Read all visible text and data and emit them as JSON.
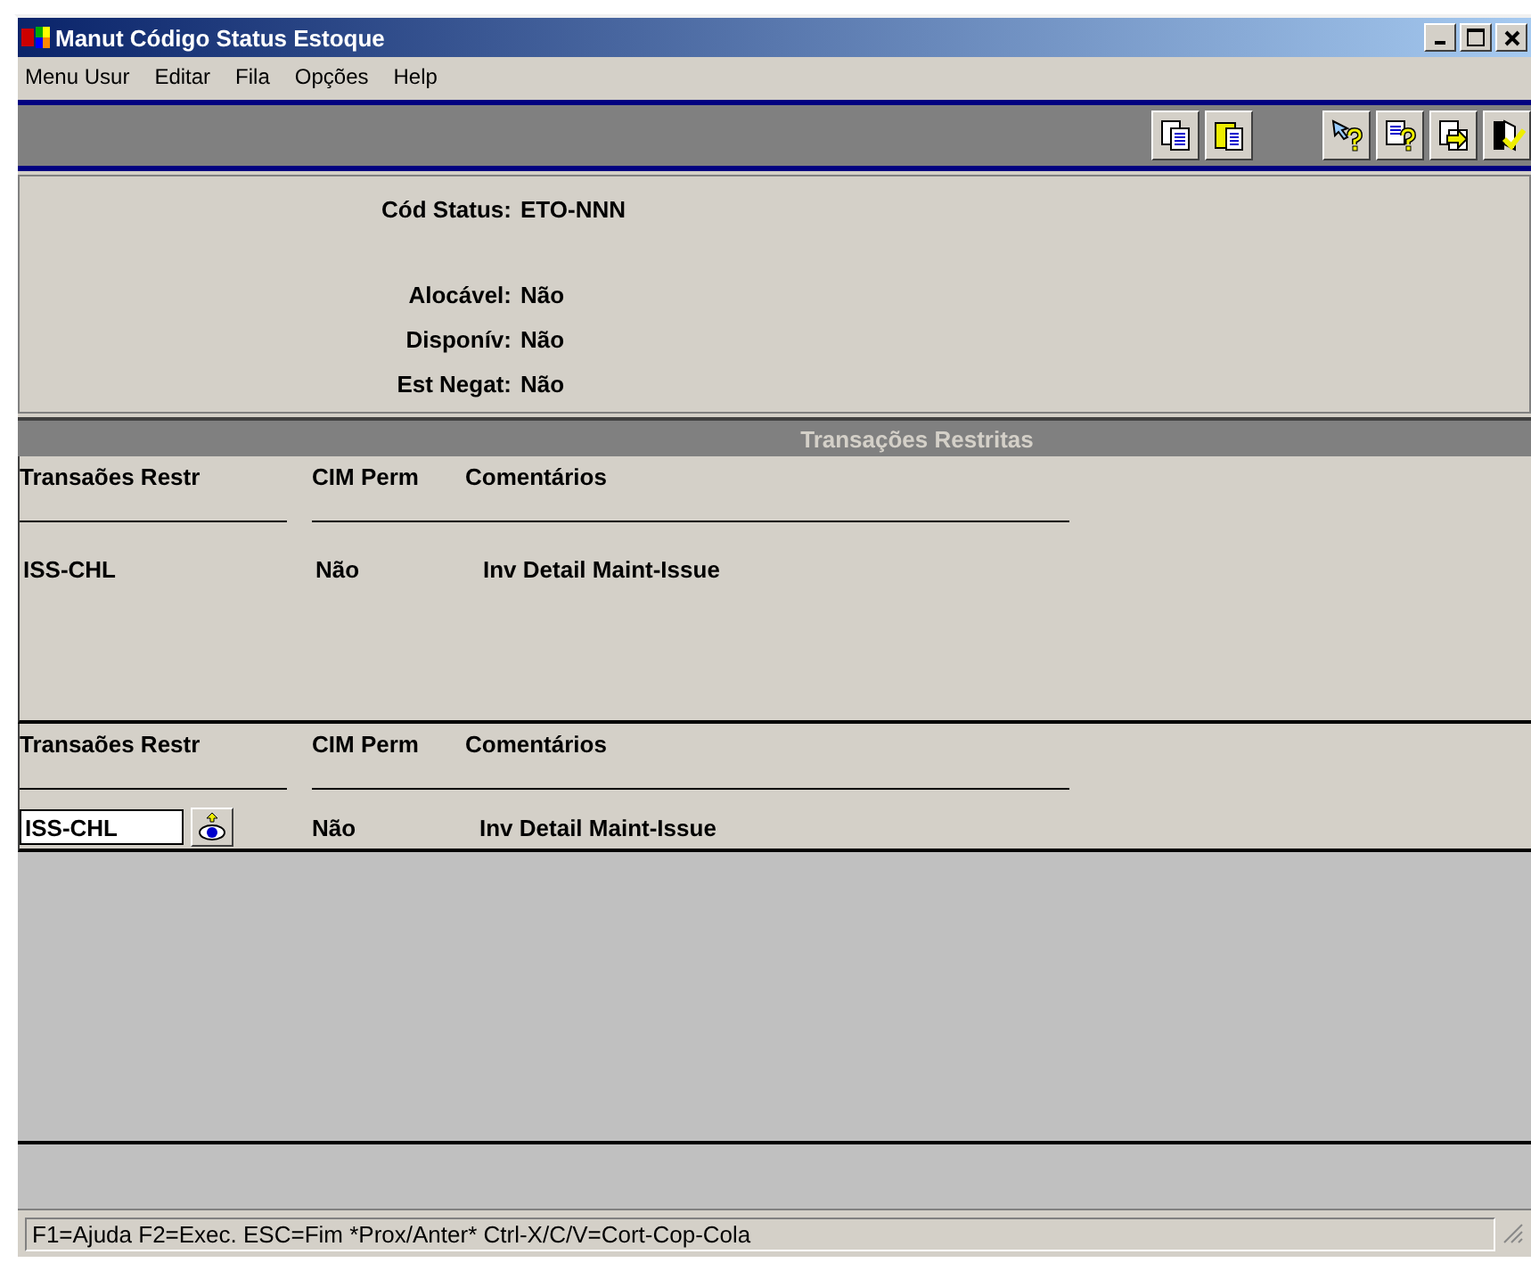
{
  "window": {
    "title": "Manut Código Status Estoque"
  },
  "menu": [
    "Menu Usur",
    "Editar",
    "Fila",
    "Opções",
    "Help"
  ],
  "fields": [
    {
      "label": "Cód Status:",
      "value": "ETO-NNN"
    },
    {
      "label": "Alocável:",
      "value": "Não"
    },
    {
      "label": "Disponív:",
      "value": "Não"
    },
    {
      "label": "Est Negat:",
      "value": "Não"
    }
  ],
  "section": {
    "title": "Transações Restritas"
  },
  "grid": {
    "columns": [
      "Transaões Restr",
      "CIM Perm",
      "Comentários"
    ],
    "rows": [
      [
        "ISS-CHL",
        "Não",
        "Inv Detail Maint-Issue"
      ]
    ]
  },
  "detail": {
    "columns": [
      "Transaões Restr",
      "CIM Perm",
      "Comentários"
    ],
    "code": "ISS-CHL",
    "cim": "Não",
    "comment": "Inv Detail Maint-Issue"
  },
  "status_bar": "F1=Ajuda F2=Exec. ESC=Fim *Prox/Anter* Ctrl-X/C/V=Cort-Cop-Cola"
}
